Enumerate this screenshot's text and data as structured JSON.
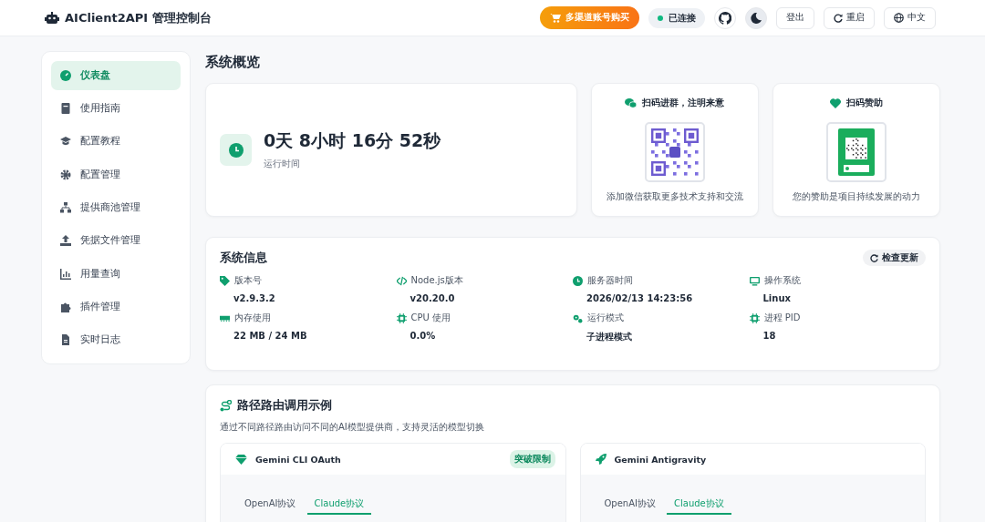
{
  "header": {
    "title": "AIClient2API 管理控制台",
    "buy_button": "多渠道账号购买",
    "status": {
      "label": "已连接",
      "connected": true
    },
    "logout": "登出",
    "restart": "重启",
    "language": "中文"
  },
  "sidebar": {
    "items": [
      {
        "label": "仪表盘",
        "selected": true
      },
      {
        "label": "使用指南",
        "selected": false
      },
      {
        "label": "配置教程",
        "selected": false
      },
      {
        "label": "配置管理",
        "selected": false
      },
      {
        "label": "提供商池管理",
        "selected": false
      },
      {
        "label": "凭据文件管理",
        "selected": false
      },
      {
        "label": "用量查询",
        "selected": false
      },
      {
        "label": "插件管理",
        "selected": false
      },
      {
        "label": "实时日志",
        "selected": false
      }
    ]
  },
  "overview": {
    "title": "系统概览",
    "uptime": {
      "value": "0天 8小时 16分 52秒",
      "label": "运行时间"
    },
    "qr_cards": [
      {
        "title": "扫码进群，注明来意",
        "caption": "添加微信获取更多技术支持和交流",
        "kind": "wechat"
      },
      {
        "title": "扫码赞助",
        "caption": "您的赞助是项目持续发展的动力",
        "kind": "pay"
      }
    ]
  },
  "system_info": {
    "title": "系统信息",
    "check_update": "检查更新",
    "items": [
      {
        "label": "版本号",
        "value": "v2.9.3.2"
      },
      {
        "label": "Node.js版本",
        "value": "v20.20.0"
      },
      {
        "label": "服务器时间",
        "value": "2026/02/13 14:23:56"
      },
      {
        "label": "操作系统",
        "value": "Linux"
      },
      {
        "label": "内存使用",
        "value": "22 MB / 24 MB"
      },
      {
        "label": "CPU 使用",
        "value": "0.0%"
      },
      {
        "label": "运行模式",
        "value": "子进程模式"
      },
      {
        "label": "进程 PID",
        "value": "18"
      }
    ]
  },
  "routing": {
    "title": "路径路由调用示例",
    "description": "通过不同路径路由访问不同的AI模型提供商，支持灵活的模型切换",
    "providers": [
      {
        "name": "Gemini CLI OAuth",
        "badge": "突破限制",
        "kind": "gem",
        "tabs": [
          {
            "label": "OpenAI协议",
            "selected": false
          },
          {
            "label": "Claude协议",
            "selected": true
          }
        ]
      },
      {
        "name": "Gemini Antigravity",
        "kind": "rocket",
        "tabs": [
          {
            "label": "OpenAI协议",
            "selected": false
          },
          {
            "label": "Claude协议",
            "selected": true
          }
        ]
      }
    ]
  }
}
